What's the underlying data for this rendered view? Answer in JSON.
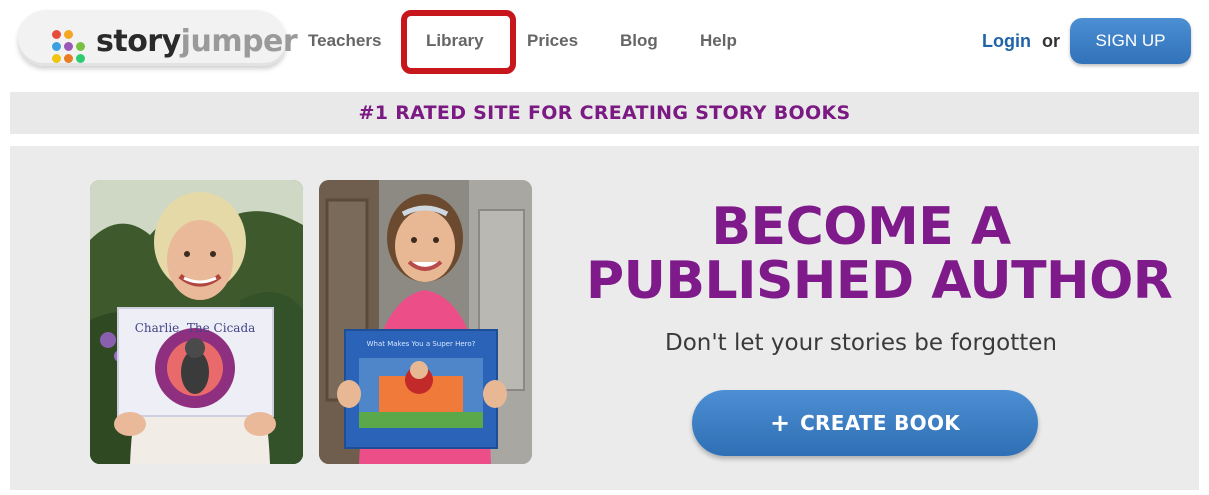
{
  "header": {
    "logo": {
      "part1": "story",
      "part2": "jumper"
    },
    "nav": [
      {
        "label": "Teachers"
      },
      {
        "label": "Library"
      },
      {
        "label": "Prices"
      },
      {
        "label": "Blog"
      },
      {
        "label": "Help"
      }
    ],
    "login_label": "Login",
    "or_label": "or",
    "signup_label": "SIGN UP"
  },
  "banner": {
    "text": "#1 RATED SITE FOR CREATING STORY BOOKS"
  },
  "hero": {
    "title_line1": "BECOME A",
    "title_line2": "PUBLISHED AUTHOR",
    "subtitle": "Don't let your stories be forgotten",
    "create_button": {
      "icon": "plus-icon",
      "plus": "+",
      "label": "CREATE BOOK"
    },
    "photos": [
      {
        "icon": "photo-woman-holding-book",
        "book_title": "Charlie, The Cicada"
      },
      {
        "icon": "photo-girl-holding-book",
        "book_title": "What Makes You a Super Hero?"
      }
    ]
  },
  "colors": {
    "brand_purple": "#7e1a8a",
    "button_blue": "#3a7fc6",
    "login_blue": "#1f63a8",
    "highlight_red": "#c8161d",
    "banner_bg": "#e9e9e9",
    "hero_bg": "#ebebeb"
  }
}
